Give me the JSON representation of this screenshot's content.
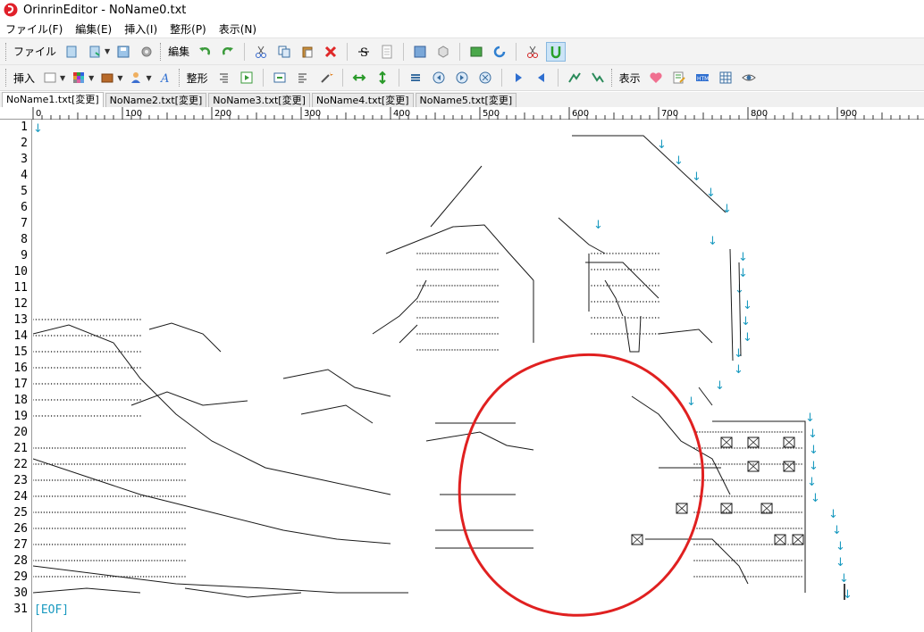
{
  "app": {
    "title": "OrinrinEditor - NoName0.txt"
  },
  "menu": [
    "ファイル(F)",
    "編集(E)",
    "挿入(I)",
    "整形(P)",
    "表示(N)"
  ],
  "toolbar1": {
    "file_label": "ファイル",
    "edit_label": "編集"
  },
  "toolbar2": {
    "insert_label": "挿入",
    "format_label": "整形",
    "view_label": "表示"
  },
  "tabs": [
    "NoName1.txt[変更]",
    "NoName2.txt[変更]",
    "NoName3.txt[変更]",
    "NoName4.txt[変更]",
    "NoName5.txt[変更]"
  ],
  "ruler": {
    "labels": [
      "0",
      "100",
      "200",
      "300",
      "400",
      "500",
      "600",
      "700",
      "800",
      "900"
    ]
  },
  "line_numbers": [
    "1",
    "2",
    "3",
    "4",
    "5",
    "6",
    "7",
    "8",
    "9",
    "10",
    "11",
    "12",
    "13",
    "14",
    "15",
    "16",
    "17",
    "18",
    "19",
    "20",
    "21",
    "22",
    "23",
    "24",
    "25",
    "26",
    "27",
    "28",
    "29",
    "30",
    "31"
  ],
  "editor": {
    "eof_marker": "[EOF]",
    "newline_glyph": "↓"
  },
  "colors": {
    "newline_marker": "#1a9ac0",
    "annotation_circle": "#e02020",
    "art_stroke": "#1a1a1a"
  }
}
